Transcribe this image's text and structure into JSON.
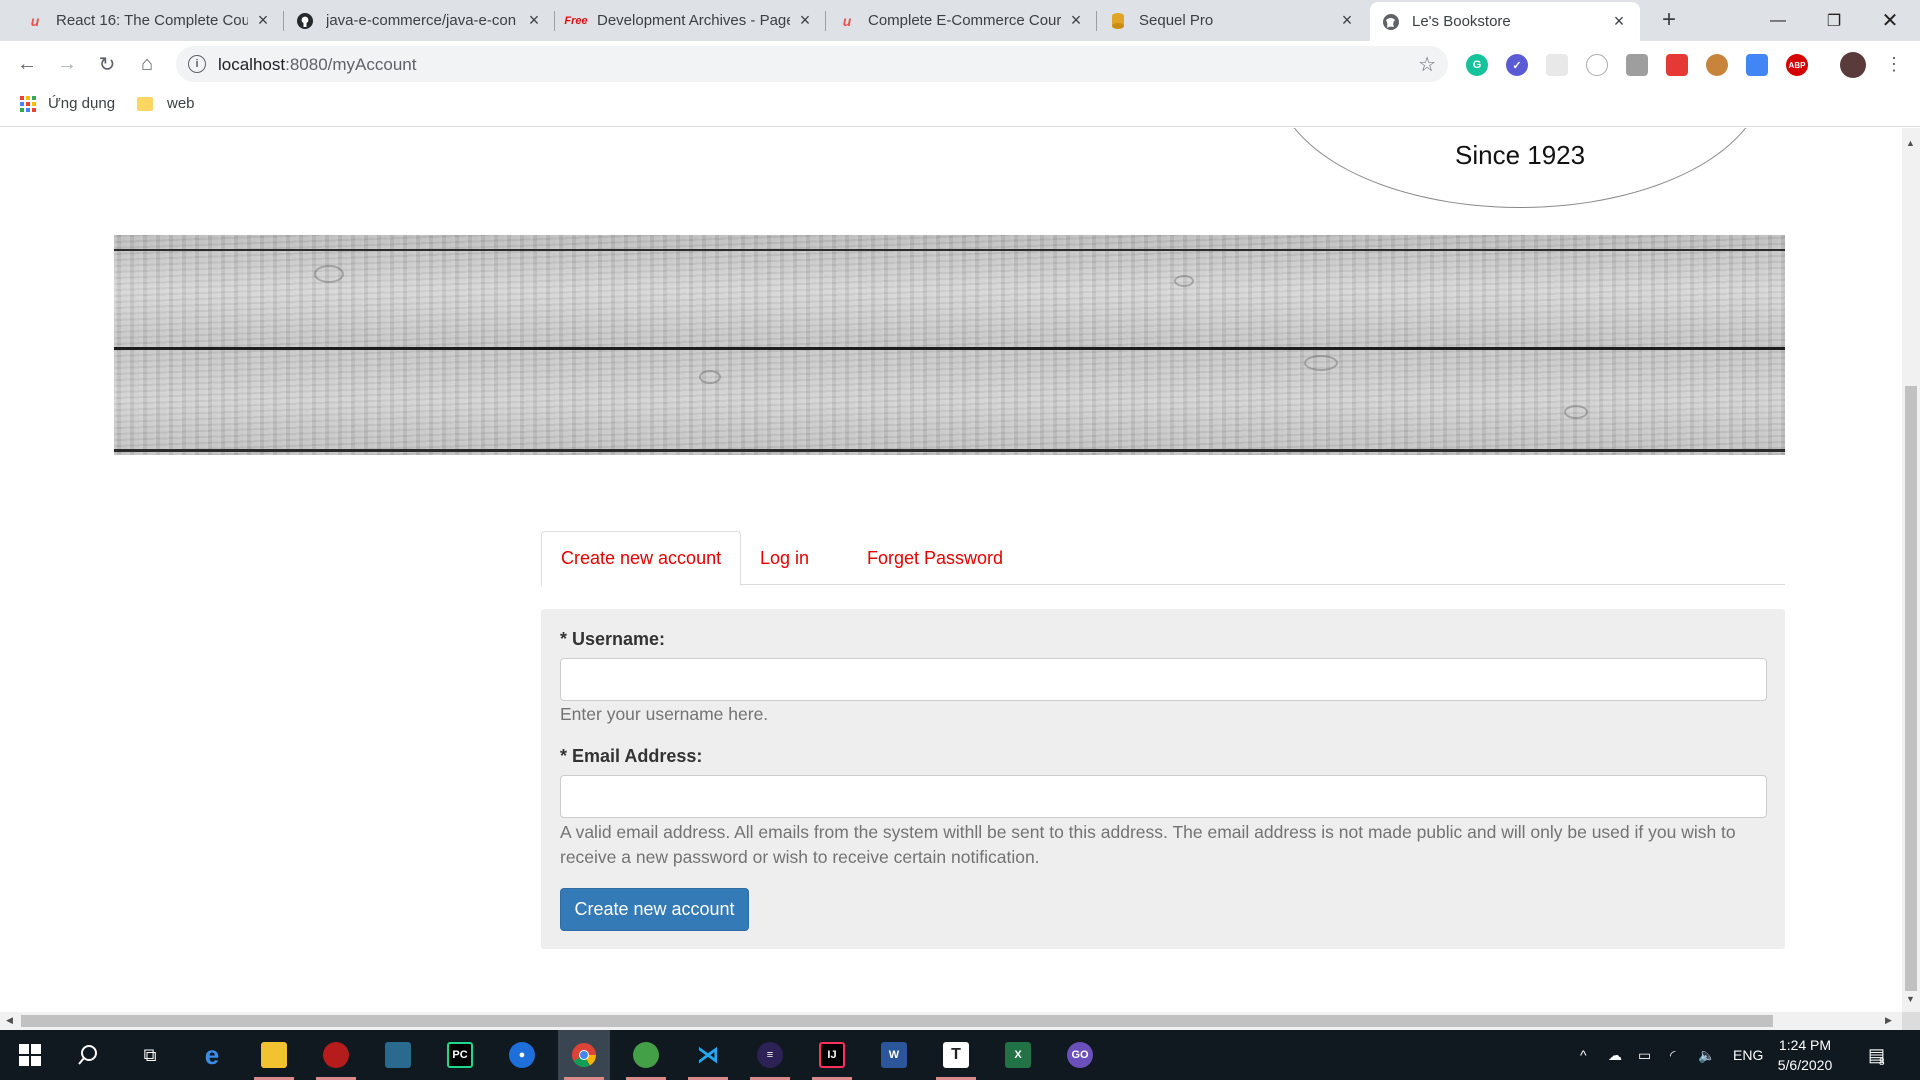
{
  "browser": {
    "tabs": [
      {
        "title": "React 16: The Complete Cour",
        "favicon": "udemy-icon"
      },
      {
        "title": "java-e-commerce/java-e-con",
        "favicon": "github-icon"
      },
      {
        "title": "Development Archives - Page",
        "favicon": "free-icon"
      },
      {
        "title": "Complete E-Commerce Cour",
        "favicon": "udemy-icon"
      },
      {
        "title": "Sequel Pro",
        "favicon": "database-icon"
      },
      {
        "title": "Le's Bookstore",
        "favicon": "globe-icon"
      }
    ],
    "active_tab_index": 5,
    "url_host": "localhost",
    "url_path": ":8080/myAccount",
    "bookmarks": [
      {
        "label": "Ứng dụng",
        "icon": "apps-icon"
      },
      {
        "label": "web",
        "icon": "folder-icon"
      }
    ],
    "extensions": [
      "G",
      "✓",
      "",
      "",
      "",
      "",
      "",
      "",
      "ABP"
    ]
  },
  "header": {
    "since": "Since 1923"
  },
  "page_tabs": [
    {
      "label": "Create new account",
      "active": true
    },
    {
      "label": "Log in",
      "active": false
    },
    {
      "label": "Forget Password",
      "active": false
    }
  ],
  "form": {
    "username_label": "* Username:",
    "username_value": "",
    "username_help": "Enter your username here.",
    "email_label": "* Email Address:",
    "email_value": "",
    "email_help": "A valid email address. All emails from the system withll be sent to this address. The email address is not made public and will only be used if you wish to receive a new password or wish to receive certain notification.",
    "submit_label": "Create new account"
  },
  "taskbar": {
    "language": "ENG",
    "time": "1:24 PM",
    "date": "5/6/2020",
    "notification_count": "8"
  },
  "colors": {
    "tab_link": "#e60000",
    "primary_button": "#337ab7",
    "panel_bg": "#eeeeee"
  }
}
